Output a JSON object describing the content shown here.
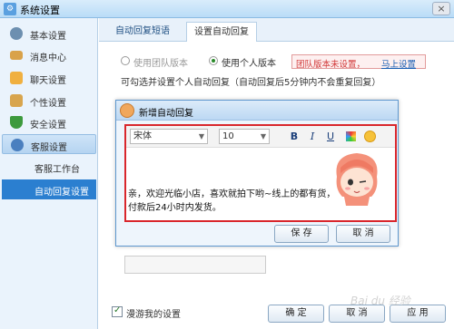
{
  "window": {
    "title": "系统设置",
    "close_glyph": "×"
  },
  "sidebar": {
    "items": [
      {
        "label": "基本设置",
        "icon": "gear-icon",
        "color": "#6d8fb0"
      },
      {
        "label": "消息中心",
        "icon": "envelope-icon",
        "color": "#d9a24a"
      },
      {
        "label": "聊天设置",
        "icon": "chat-icon",
        "color": "#f0b040"
      },
      {
        "label": "个性设置",
        "icon": "document-icon",
        "color": "#d8a54e"
      },
      {
        "label": "安全设置",
        "icon": "shield-icon",
        "color": "#3d9a3d"
      },
      {
        "label": "客服设置",
        "icon": "user-service-icon",
        "color": "#4a7fbf"
      }
    ],
    "sub_items": [
      {
        "label": "客服工作台"
      },
      {
        "label": "自动回复设置",
        "selected": true
      }
    ]
  },
  "tabs": [
    {
      "label": "自动回复短语"
    },
    {
      "label": "设置自动回复",
      "active": true
    }
  ],
  "options": {
    "team_version": "使用团队版本",
    "personal_version": "使用个人版本",
    "warning": "团队版本未设置，",
    "warning_link": "马上设置",
    "hint": "可勾选并设置个人自动回复（自动回复后5分钟内不会重复回复）"
  },
  "dialog": {
    "title": "新增自动回复",
    "font_family": "宋体",
    "font_size": "10",
    "bold": "B",
    "italic": "I",
    "underline": "U",
    "content_line1": "亲，欢迎光临小店，喜欢就拍下哟~线上的都有货，",
    "content_line2": "付款后24小时内发货。",
    "save": "保 存",
    "cancel": "取 消"
  },
  "footer": {
    "roaming_label": "漫游我的设置",
    "roaming_checked": true,
    "ok": "确 定",
    "cancel": "取 消",
    "apply": "应 用"
  },
  "watermark": "Bai du 经验"
}
